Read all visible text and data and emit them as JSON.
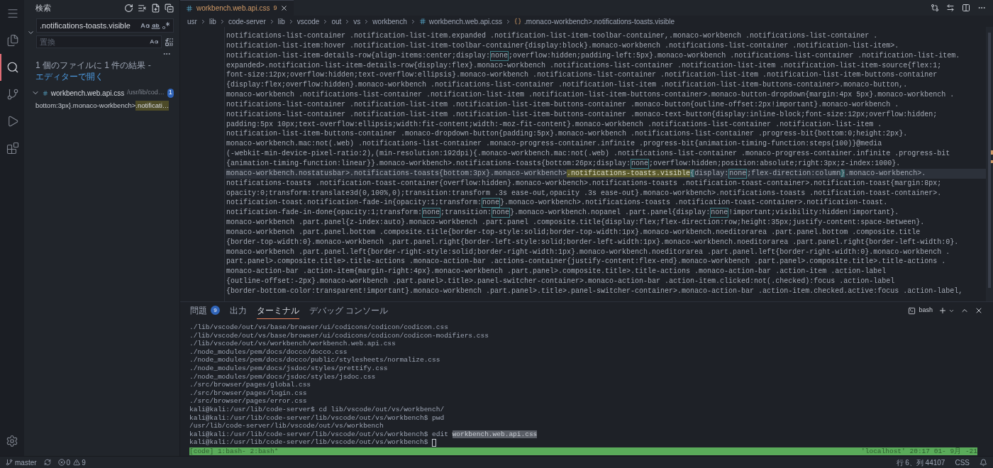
{
  "activity_bar": {
    "items": [
      {
        "kind": "menu",
        "selected": false
      },
      {
        "kind": "explorer",
        "selected": false
      },
      {
        "kind": "search",
        "selected": true
      },
      {
        "kind": "source-control",
        "selected": false
      },
      {
        "kind": "run",
        "selected": false
      },
      {
        "kind": "extensions",
        "selected": false
      }
    ]
  },
  "sidebar": {
    "title": "検索",
    "search": {
      "value": ".notifications-toasts.visible"
    },
    "replace": {
      "placeholder": "置換"
    },
    "summary": "1 個のファイルに 1 件の結果 - ",
    "summary_link": "エディターで開く",
    "results": [
      {
        "file": "workbench.web.api.css",
        "path": "/usr/lib/cod…",
        "count": "1",
        "expanded": true,
        "matches": [
          {
            "before": "bottom:3px}.monaco-workbench>",
            "match": ".notificati…"
          }
        ]
      }
    ]
  },
  "editor": {
    "tabs": [
      {
        "label": "workbench.web.api.css",
        "problems": "9",
        "selected": true
      }
    ],
    "breadcrumb": [
      {
        "kind": "folder",
        "label": "usr"
      },
      {
        "kind": "folder",
        "label": "lib"
      },
      {
        "kind": "folder",
        "label": "code-server"
      },
      {
        "kind": "folder",
        "label": "lib"
      },
      {
        "kind": "folder",
        "label": "vscode"
      },
      {
        "kind": "folder",
        "label": "out"
      },
      {
        "kind": "folder",
        "label": "vs"
      },
      {
        "kind": "folder",
        "label": "workbench"
      },
      {
        "kind": "file",
        "label": "workbench.web.api.css"
      },
      {
        "kind": "symbol",
        "label": ".monaco-workbench>.notifications-toasts.visible"
      }
    ],
    "lines": [
      {
        "current": false,
        "segments": [
          {
            "kind": "plain",
            "text": "notifications-list-container .notification-list-item.expanded .notification-list-item-toolbar-container,.monaco-workbench .notifications-list-container ."
          }
        ]
      },
      {
        "current": false,
        "segments": [
          {
            "kind": "plain",
            "text": "notification-list-item:hover .notification-list-item-toolbar-container{display:block}.monaco-workbench .notifications-list-container .notification-list-item>."
          }
        ]
      },
      {
        "current": false,
        "segments": [
          {
            "kind": "plain",
            "text": "notification-list-item-details-row{align-items:center;display:"
          },
          {
            "kind": "boxed",
            "text": "none"
          },
          {
            "kind": "plain",
            "text": ";overflow:hidden;padding-left:5px}.monaco-workbench .notifications-list-container .notification-list-item."
          }
        ]
      },
      {
        "current": false,
        "segments": [
          {
            "kind": "plain",
            "text": "expanded>.notification-list-item-details-row{display:flex}.monaco-workbench .notifications-list-container .notification-list-item .notification-list-item-source{flex:1;"
          }
        ]
      },
      {
        "current": false,
        "segments": [
          {
            "kind": "plain",
            "text": "font-size:12px;overflow:hidden;text-overflow:ellipsis}.monaco-workbench .notifications-list-container .notification-list-item .notification-list-item-buttons-container"
          }
        ]
      },
      {
        "current": false,
        "segments": [
          {
            "kind": "plain",
            "text": "{display:flex;overflow:hidden}.monaco-workbench .notifications-list-container .notification-list-item .notification-list-item-buttons-container>.monaco-button,."
          }
        ]
      },
      {
        "current": false,
        "segments": [
          {
            "kind": "plain",
            "text": "monaco-workbench .notifications-list-container .notification-list-item .notification-list-item-buttons-container>.monaco-button-dropdown{margin:4px 5px}.monaco-workbench ."
          }
        ]
      },
      {
        "current": false,
        "segments": [
          {
            "kind": "plain",
            "text": "notifications-list-container .notification-list-item .notification-list-item-buttons-container .monaco-button{outline-offset:2px!important}.monaco-workbench ."
          }
        ]
      },
      {
        "current": false,
        "segments": [
          {
            "kind": "plain",
            "text": "notifications-list-container .notification-list-item .notification-list-item-buttons-container .monaco-text-button{display:inline-block;font-size:12px;overflow:hidden;"
          }
        ]
      },
      {
        "current": false,
        "segments": [
          {
            "kind": "plain",
            "text": "padding:5px 10px;text-overflow:ellipsis;width:fit-content;width:-moz-fit-content}.monaco-workbench .notifications-list-container .notification-list-item ."
          }
        ]
      },
      {
        "current": false,
        "segments": [
          {
            "kind": "plain",
            "text": "notification-list-item-buttons-container .monaco-dropdown-button{padding:5px}.monaco-workbench .notifications-list-container .progress-bit{bottom:0;height:2px}."
          }
        ]
      },
      {
        "current": false,
        "segments": [
          {
            "kind": "plain",
            "text": "monaco-workbench.mac:not(.web) .notifications-list-container .monaco-progress-container.infinite .progress-bit{animation-timing-function:steps(100)}@media"
          }
        ]
      },
      {
        "current": false,
        "segments": [
          {
            "kind": "plain",
            "text": "(-webkit-min-device-pixel-ratio:2),(min-resolution:192dpi){.monaco-workbench.mac:not(.web) .notifications-list-container .monaco-progress-container.infinite .progress-bit"
          }
        ]
      },
      {
        "current": false,
        "segments": [
          {
            "kind": "plain",
            "text": "{animation-timing-function:linear}}.monaco-workbench>.notifications-toasts{bottom:26px;display:"
          },
          {
            "kind": "boxed",
            "text": "none"
          },
          {
            "kind": "plain",
            "text": ";overflow:hidden;position:absolute;right:3px;z-index:1000}."
          }
        ]
      },
      {
        "current": true,
        "segments": [
          {
            "kind": "plain",
            "text": "monaco-workbench.nostatusbar>.notifications-toasts{bottom:3px}.monaco-workbench>"
          },
          {
            "kind": "match",
            "text": ".notifications-toasts.visible"
          },
          {
            "kind": "bracket",
            "text": "{"
          },
          {
            "kind": "plain",
            "text": "display:"
          },
          {
            "kind": "boxed",
            "text": "none"
          },
          {
            "kind": "plain",
            "text": ";flex-direction:column"
          },
          {
            "kind": "bracket",
            "text": "}"
          },
          {
            "kind": "plain",
            "text": ".monaco-workbench>."
          }
        ]
      },
      {
        "current": false,
        "segments": [
          {
            "kind": "plain",
            "text": "notifications-toasts .notification-toast-container{overflow:hidden}.monaco-workbench>.notifications-toasts .notification-toast-container>.notification-toast{margin:8px;"
          }
        ]
      },
      {
        "current": false,
        "segments": [
          {
            "kind": "plain",
            "text": "opacity:0;transform:translate3d(0,100%,0);transition:transform .3s ease-out,opacity .3s ease-out}.monaco-workbench>.notifications-toasts .notification-toast-container>."
          }
        ]
      },
      {
        "current": false,
        "segments": [
          {
            "kind": "plain",
            "text": "notification-toast.notification-fade-in{opacity:1;transform:"
          },
          {
            "kind": "boxed",
            "text": "none"
          },
          {
            "kind": "plain",
            "text": "}.monaco-workbench>.notifications-toasts .notification-toast-container>.notification-toast."
          }
        ]
      },
      {
        "current": false,
        "segments": [
          {
            "kind": "plain",
            "text": "notification-fade-in-done{opacity:1;transform:"
          },
          {
            "kind": "boxed",
            "text": "none"
          },
          {
            "kind": "plain",
            "text": ";transition:"
          },
          {
            "kind": "boxed",
            "text": "none"
          },
          {
            "kind": "plain",
            "text": "}.monaco-workbench.nopanel .part.panel{display:"
          },
          {
            "kind": "boxed",
            "text": "none"
          },
          {
            "kind": "plain",
            "text": "!important;visibility:hidden!important}."
          }
        ]
      },
      {
        "current": false,
        "segments": [
          {
            "kind": "plain",
            "text": "monaco-workbench .part.panel{z-index:auto}.monaco-workbench .part.panel .composite.title{display:flex;flex-direction:row;height:35px;justify-content:space-between}."
          }
        ]
      },
      {
        "current": false,
        "segments": [
          {
            "kind": "plain",
            "text": "monaco-workbench .part.panel.bottom .composite.title{border-top-style:solid;border-top-width:1px}.monaco-workbench.noeditorarea .part.panel.bottom .composite.title"
          }
        ]
      },
      {
        "current": false,
        "segments": [
          {
            "kind": "plain",
            "text": "{border-top-width:0}.monaco-workbench .part.panel.right{border-left-style:solid;border-left-width:1px}.monaco-workbench.noeditorarea .part.panel.right{border-left-width:0}."
          }
        ]
      },
      {
        "current": false,
        "segments": [
          {
            "kind": "plain",
            "text": "monaco-workbench .part.panel.left{border-right-style:solid;border-right-width:1px}.monaco-workbench.noeditorarea .part.panel.left{border-right-width:0}.monaco-workbench ."
          }
        ]
      },
      {
        "current": false,
        "segments": [
          {
            "kind": "plain",
            "text": "part.panel>.composite.title>.title-actions .monaco-action-bar .actions-container{justify-content:flex-end}.monaco-workbench .part.panel>.composite.title>.title-actions ."
          }
        ]
      },
      {
        "current": false,
        "segments": [
          {
            "kind": "plain",
            "text": "monaco-action-bar .action-item{margin-right:4px}.monaco-workbench .part.panel>.composite.title>.title-actions .monaco-action-bar .action-item .action-label"
          }
        ]
      },
      {
        "current": false,
        "segments": [
          {
            "kind": "plain",
            "text": "{outline-offset:-2px}.monaco-workbench .part.panel>.title>.panel-switcher-container>.monaco-action-bar .action-item.clicked:not(.checked):focus .action-label"
          }
        ]
      },
      {
        "current": false,
        "segments": [
          {
            "kind": "plain",
            "text": "{border-bottom-color:transparent!important}.monaco-workbench .part.panel>.title>.panel-switcher-container>.monaco-action-bar .action-item.checked.active:focus .action-label,"
          }
        ]
      }
    ]
  },
  "panel": {
    "tabs": [
      {
        "label": "問題",
        "badge": "9",
        "selected": false
      },
      {
        "label": "出力",
        "selected": false
      },
      {
        "label": "ターミナル",
        "selected": true
      },
      {
        "label": "デバッグ コンソール",
        "selected": false
      }
    ],
    "terminal_name": "bash",
    "terminal_lines": [
      {
        "cursor": false,
        "segments": [
          {
            "kind": "plain",
            "text": "./lib/vscode/out/vs/base/browser/ui/codicons/codicon/codicon.css"
          }
        ]
      },
      {
        "cursor": false,
        "segments": [
          {
            "kind": "plain",
            "text": "./lib/vscode/out/vs/base/browser/ui/codicons/codicon/codicon-modifiers.css"
          }
        ]
      },
      {
        "cursor": false,
        "segments": [
          {
            "kind": "plain",
            "text": "./lib/vscode/out/vs/workbench/workbench.web.api.css"
          }
        ]
      },
      {
        "cursor": false,
        "segments": [
          {
            "kind": "plain",
            "text": "./node_modules/pem/docs/docco/docco.css"
          }
        ]
      },
      {
        "cursor": false,
        "segments": [
          {
            "kind": "plain",
            "text": "./node_modules/pem/docs/docco/public/stylesheets/normalize.css"
          }
        ]
      },
      {
        "cursor": false,
        "segments": [
          {
            "kind": "plain",
            "text": "./node_modules/pem/docs/jsdoc/styles/prettify.css"
          }
        ]
      },
      {
        "cursor": false,
        "segments": [
          {
            "kind": "plain",
            "text": "./node_modules/pem/docs/jsdoc/styles/jsdoc.css"
          }
        ]
      },
      {
        "cursor": false,
        "segments": [
          {
            "kind": "plain",
            "text": "./src/browser/pages/global.css"
          }
        ]
      },
      {
        "cursor": false,
        "segments": [
          {
            "kind": "plain",
            "text": "./src/browser/pages/login.css"
          }
        ]
      },
      {
        "cursor": false,
        "segments": [
          {
            "kind": "plain",
            "text": "./src/browser/pages/error.css"
          }
        ]
      },
      {
        "cursor": false,
        "segments": [
          {
            "kind": "plain",
            "text": "kali@kali:/usr/lib/code-server$ cd lib/vscode/out/vs/workbench/"
          }
        ]
      },
      {
        "cursor": false,
        "segments": [
          {
            "kind": "plain",
            "text": "kali@kali:/usr/lib/code-server/lib/vscode/out/vs/workbench$ pwd"
          }
        ]
      },
      {
        "cursor": false,
        "segments": [
          {
            "kind": "plain",
            "text": "/usr/lib/code-server/lib/vscode/out/vs/workbench"
          }
        ]
      },
      {
        "cursor": false,
        "segments": [
          {
            "kind": "plain",
            "text": "kali@kali:/usr/lib/code-server/lib/vscode/out/vs/workbench$ edit "
          },
          {
            "kind": "selected",
            "text": "workbench.web.api.css"
          }
        ]
      },
      {
        "cursor": true,
        "segments": [
          {
            "kind": "plain",
            "text": "kali@kali:/usr/lib/code-server/lib/vscode/out/vs/workbench$ "
          }
        ]
      }
    ],
    "tmux_left": "[code] 1:bash- 2:bash*",
    "tmux_right": "'localhost' 20:17 01- 9月 -21"
  },
  "status_bar": {
    "branch": "master",
    "errors": "0",
    "warnings": "9",
    "position": "行 6、列 44107",
    "language": "CSS"
  }
}
